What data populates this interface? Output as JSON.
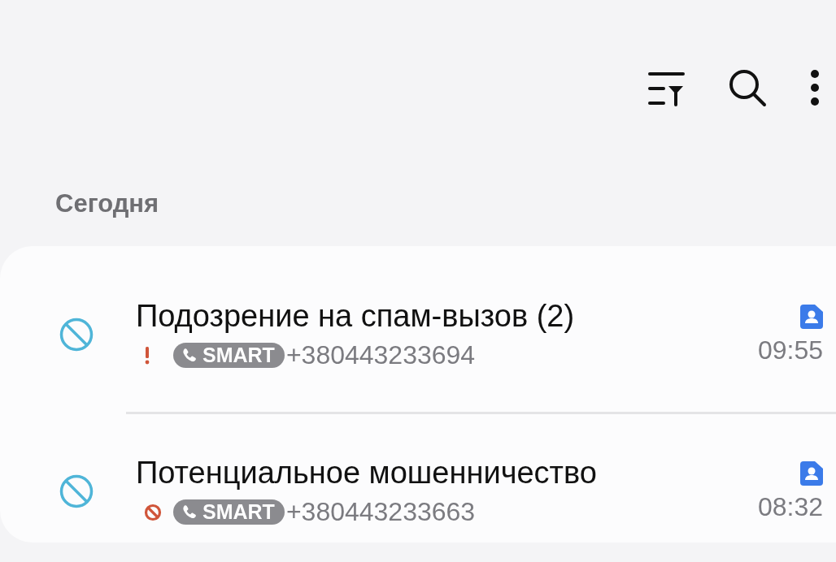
{
  "section_title": "Сегодня",
  "calls": [
    {
      "title": "Подозрение на спам-вызов (2)",
      "kind": "warning",
      "badge": "SMART",
      "number": "+380443233694",
      "time": "09:55"
    },
    {
      "title": "Потенциальное мошенничество",
      "kind": "blocked",
      "badge": "SMART",
      "number": "+380443233663",
      "time": "08:32"
    }
  ]
}
